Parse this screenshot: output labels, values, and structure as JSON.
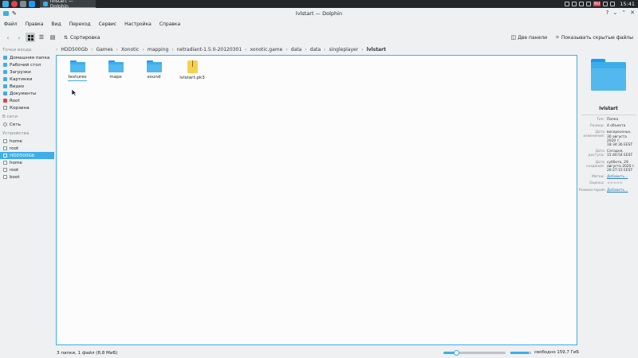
{
  "taskbar": {
    "task_title": "lvlstart — Dolphin",
    "tray_lang": "RU",
    "clock": "15:41",
    "colors": {
      "taskbar_bg": "#232629",
      "accent": "#3daee9"
    }
  },
  "window": {
    "title": "lvlstart — Dolphin"
  },
  "menubar": {
    "items": [
      "Файл",
      "Правка",
      "Вид",
      "Переход",
      "Сервис",
      "Настройка",
      "Справка"
    ]
  },
  "toolbar": {
    "back_icon": "chevron-left-icon",
    "forward_icon": "chevron-right-icon",
    "sort_label": "Сортировка",
    "split_label": "Две панели",
    "hidden_label": "Показывать скрытые файлы"
  },
  "breadcrumb": {
    "items": [
      "HDD500Gb",
      "Games",
      "Xonotic",
      "mapping",
      "netradiant-1.5.0-20120301",
      "xonotic.game",
      "data",
      "data",
      "singleplayer",
      "lvlstart"
    ]
  },
  "sidebar": {
    "places_title": "Точки входа",
    "places": [
      "Домашняя папка",
      "Рабочий стол",
      "Загрузки",
      "Картинки",
      "Видео",
      "Документы",
      "Root",
      "Корзина"
    ],
    "network_title": "В сети",
    "network": [
      "Сеть"
    ],
    "devices_title": "Устройства",
    "devices": [
      "home",
      "root",
      "HDD500Gb",
      "home",
      "root",
      "boot"
    ],
    "selected_device": "HDD500Gb"
  },
  "files": [
    {
      "name": "textures",
      "type": "folder"
    },
    {
      "name": "maps",
      "type": "folder"
    },
    {
      "name": "sound",
      "type": "folder"
    },
    {
      "name": "lvlstart.pk3",
      "type": "archive"
    }
  ],
  "info": {
    "name": "lvlstart",
    "rows": [
      {
        "k": "Тип:",
        "v": "Папка"
      },
      {
        "k": "Размер:",
        "v": "4 объекта"
      },
      {
        "k": "Дата изменения:",
        "v": "воскресенье, 30 августа 2020 г. 18:34:36 EEST"
      },
      {
        "k": "Дата доступа:",
        "v": "Сегодня, 15:40:54 EEST"
      },
      {
        "k": "Дата создания:",
        "v": "суббота, 29 августа 2020 г. 20:27:15 EEST"
      },
      {
        "k": "Метки:",
        "v": "Добавить..."
      },
      {
        "k": "Оценка:",
        "v": "☆☆☆☆☆"
      },
      {
        "k": "Комментарий:",
        "v": "Добавить..."
      }
    ]
  },
  "status": {
    "text": "3 папки, 1 файл (8,8 МиБ)",
    "zoom_fraction": 0.2,
    "space_used_fraction": 0.9,
    "space_text": "свободно 159,7 ГиБ"
  }
}
